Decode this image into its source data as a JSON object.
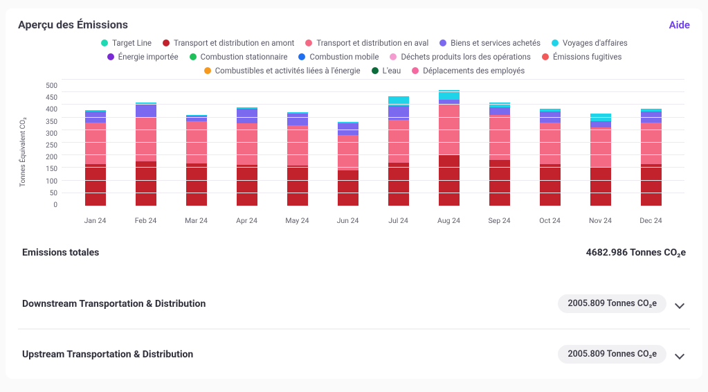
{
  "header": {
    "title": "Aperçu des Émissions",
    "help_label": "Aide"
  },
  "colors": {
    "target_line": "#1fd9b3",
    "upstream": "#c1222b",
    "downstream": "#f46a85",
    "purchased_goods": "#7b6af0",
    "business_travel": "#1fd3e8",
    "imported_energy": "#7a2bd6",
    "stationary_comb": "#1fbf5a",
    "mobile_comb": "#1f6ff0",
    "waste": "#f49bd0",
    "fugitive": "#f25a5a",
    "fuel_energy": "#f59a1f",
    "water": "#0b6b3a",
    "employee_commute": "#f46aa0"
  },
  "legend": [
    {
      "key": "target_line",
      "label": "Target Line"
    },
    {
      "key": "upstream",
      "label": "Transport et distribution en amont"
    },
    {
      "key": "downstream",
      "label": "Transport et distribution en aval"
    },
    {
      "key": "purchased_goods",
      "label": "Biens et services achetés"
    },
    {
      "key": "business_travel",
      "label": "Voyages d'affaires"
    },
    {
      "key": "imported_energy",
      "label": "Énergie importée"
    },
    {
      "key": "stationary_comb",
      "label": "Combustion stationnaire"
    },
    {
      "key": "mobile_comb",
      "label": "Combustion mobile"
    },
    {
      "key": "waste",
      "label": "Déchets produits lors des opérations"
    },
    {
      "key": "fugitive",
      "label": "Émissions fugitives"
    },
    {
      "key": "fuel_energy",
      "label": "Combustibles et activités liées à l'énergie"
    },
    {
      "key": "water",
      "label": "L'eau"
    },
    {
      "key": "employee_commute",
      "label": "Déplacements des employés"
    }
  ],
  "chart_data": {
    "type": "bar",
    "ylabel": "Tonnes Équivalent CO₂",
    "ylim": [
      0,
      500
    ],
    "ystep": 50,
    "categories": [
      "Jan 24",
      "Feb 24",
      "Mar 24",
      "Apr 24",
      "May 24",
      "Jun 24",
      "Jul 24",
      "Aug 24",
      "Sep 24",
      "Oct 24",
      "Nov 24",
      "Dec 24"
    ],
    "series": [
      {
        "key": "upstream",
        "values": [
          165,
          175,
          168,
          163,
          160,
          140,
          170,
          200,
          180,
          165,
          155,
          165
        ]
      },
      {
        "key": "downstream",
        "values": [
          165,
          175,
          168,
          163,
          160,
          140,
          170,
          200,
          180,
          165,
          155,
          165
        ]
      },
      {
        "key": "purchased_goods",
        "values": [
          45,
          55,
          22,
          60,
          45,
          48,
          55,
          20,
          30,
          45,
          25,
          45
        ]
      },
      {
        "key": "business_travel",
        "values": [
          5,
          5,
          2,
          3,
          5,
          5,
          40,
          40,
          20,
          10,
          30,
          10
        ]
      }
    ]
  },
  "summary": {
    "total_label": "Emissions totales",
    "total_value": "4682.986 Tonnes CO₂e",
    "rows": [
      {
        "label": "Downstream Transportation & Distribution",
        "pill": "2005.809 Tonnes CO₂e"
      },
      {
        "label": "Upstream Transportation & Distribution",
        "pill": "2005.809 Tonnes CO₂e"
      }
    ]
  }
}
